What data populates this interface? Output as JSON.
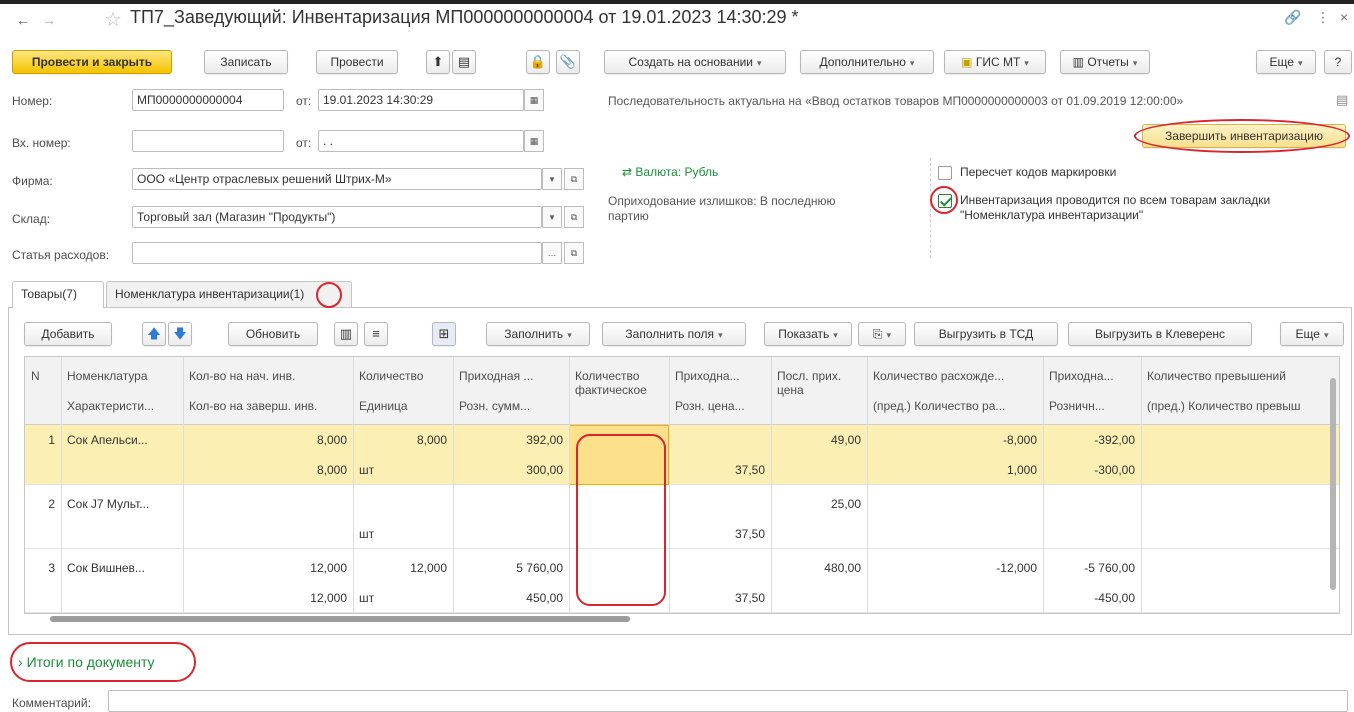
{
  "window": {
    "title": "ТП7_Заведующий: Инвентаризация МП0000000000004 от 19.01.2023 14:30:29 *"
  },
  "toolbar": {
    "post_close": "Провести и закрыть",
    "write": "Записать",
    "post": "Провести",
    "create_based": "Создать на основании",
    "additional": "Дополнительно",
    "gis_mt": "ГИС МТ",
    "reports": "Отчеты",
    "more": "Еще",
    "help": "?"
  },
  "form": {
    "number_label": "Номер:",
    "number_value": "МП0000000000004",
    "from_label": "от:",
    "date_value": "19.01.2023 14:30:29",
    "in_number_label": "Вх. номер:",
    "in_from_label": "от:",
    "in_date_value": " .  .",
    "firm_label": "Фирма:",
    "firm_value": "ООО «Центр отраслевых решений Штрих-М»",
    "warehouse_label": "Склад:",
    "warehouse_value": "Торговый зал (Магазин \"Продукты\")",
    "expense_label": "Статья расходов:",
    "expense_value": "",
    "sequence_note": "Последовательность актуальна на «Ввод остатков товаров МП0000000000003 от 01.09.2019 12:00:00»",
    "finish_button": "Завершить инвентаризацию",
    "currency": "Валюта: Рубль",
    "surplus_line1": "Оприходование излишков: В последнюю",
    "surplus_line2": "партию",
    "recount_label": "Пересчет кодов маркировки",
    "recount_checked": false,
    "all_goods_line1": "Инвентаризация проводится по всем товарам закладки",
    "all_goods_line2": "\"Номенклатура инвентаризации\"",
    "all_goods_checked": true
  },
  "tabs": [
    {
      "label": "Товары",
      "count": "(7)"
    },
    {
      "label": "Номенклатура инвентаризации",
      "count": "(1)"
    }
  ],
  "table_toolbar": {
    "add": "Добавить",
    "refresh": "Обновить",
    "fill": "Заполнить",
    "fill_fields": "Заполнить поля",
    "show": "Показать",
    "export_tsd": "Выгрузить в ТСД",
    "export_kleverens": "Выгрузить в Клеверенс",
    "more": "Еще"
  },
  "table": {
    "header_row1": [
      "N",
      "Номенклатура",
      "Кол-во на нач. инв.",
      "Количество",
      "Приходная ...",
      "Количество фактическое",
      "Приходна...",
      "Посл. прих. цена",
      "Количество расхожде...",
      "Приходна...",
      "Количество превышений"
    ],
    "header_row2": [
      "",
      "Характеристи...",
      "Кол-во на заверш. инв.",
      "Единица",
      "Розн. сумм...",
      "",
      "Розн. цена...",
      "",
      "(пред.) Количество ра...",
      "Розничн...",
      "(пред.) Количество превыш"
    ],
    "rows": [
      {
        "n": "1",
        "name": "Сок Апельси...",
        "r1": [
          "8,000",
          "8,000",
          "392,00",
          "",
          "",
          "49,00",
          "-8,000",
          "-392,00",
          ""
        ],
        "r2": [
          "8,000",
          "шт",
          "300,00",
          "",
          "37,50",
          "",
          "1,000",
          "-300,00",
          ""
        ]
      },
      {
        "n": "2",
        "name": "Сок J7 Мульт...",
        "r1": [
          "",
          "",
          "",
          "",
          "",
          "25,00",
          "",
          "",
          ""
        ],
        "r2": [
          "",
          "шт",
          "",
          "",
          "37,50",
          "",
          "",
          "",
          ""
        ]
      },
      {
        "n": "3",
        "name": "Сок Вишнев...",
        "r1": [
          "12,000",
          "12,000",
          "5 760,00",
          "",
          "",
          "480,00",
          "-12,000",
          "-5 760,00",
          ""
        ],
        "r2": [
          "12,000",
          "шт",
          "450,00",
          "",
          "37,50",
          "",
          "",
          "-450,00",
          ""
        ]
      }
    ]
  },
  "footer": {
    "totals": "Итоги по документу",
    "comment_label": "Комментарий:"
  },
  "colors": {
    "accent_yellow": "#f4c200",
    "selected_row": "#fcefb4",
    "active_cell": "#fde08a",
    "annotation_red": "#d9262e",
    "link_green": "#1a8f3a"
  }
}
